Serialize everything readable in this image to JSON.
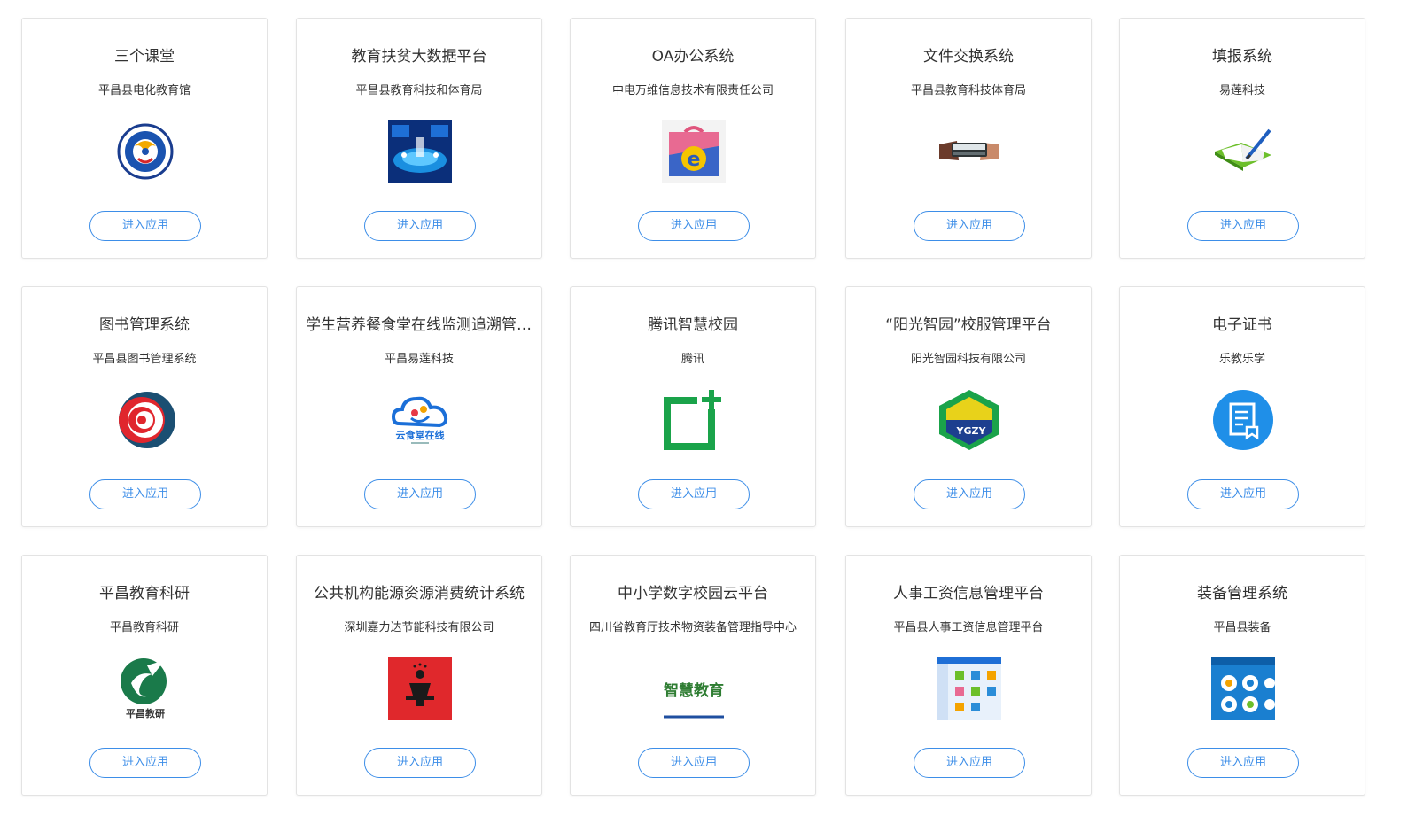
{
  "apps": [
    {
      "title": "三个课堂",
      "org": "平昌县电化教育馆",
      "icon": "edu-emblem-icon",
      "button_label": "进入应用"
    },
    {
      "title": "教育扶贫大数据平台",
      "org": "平昌县教育科技和体育局",
      "icon": "big-data-dashboard-icon",
      "button_label": "进入应用"
    },
    {
      "title": "OA办公系统",
      "org": "中电万维信息技术有限责任公司",
      "icon": "briefcase-e-icon",
      "button_label": "进入应用"
    },
    {
      "title": "文件交换系统",
      "org": "平昌县教育科技体育局",
      "icon": "document-handover-icon",
      "button_label": "进入应用"
    },
    {
      "title": "填报系统",
      "org": "易莲科技",
      "icon": "notebook-pen-icon",
      "button_label": "进入应用"
    },
    {
      "title": "图书管理系统",
      "org": "平昌县图书管理系统",
      "icon": "swirl-logo-icon",
      "button_label": "进入应用"
    },
    {
      "title": "学生营养餐食堂在线监测追溯管理系统",
      "org": "平昌易莲科技",
      "icon": "cloud-canteen-icon",
      "logo_text": "云食堂在线",
      "button_label": "进入应用"
    },
    {
      "title": "腾讯智慧校园",
      "org": "腾讯",
      "icon": "smart-campus-icon",
      "button_label": "进入应用"
    },
    {
      "title": "“阳光智园”校服管理平台",
      "org": "阳光智园科技有限公司",
      "icon": "ygzy-logo-icon",
      "logo_text": "YGZY",
      "button_label": "进入应用"
    },
    {
      "title": "电子证书",
      "org": "乐教乐学",
      "icon": "certificate-icon",
      "button_label": "进入应用"
    },
    {
      "title": "平昌教育科研",
      "org": "平昌教育科研",
      "icon": "edu-research-logo-icon",
      "logo_text": "平昌教研",
      "button_label": "进入应用"
    },
    {
      "title": "公共机构能源资源消费统计系统",
      "org": "深圳嘉力达节能科技有限公司",
      "icon": "energy-stats-icon",
      "button_label": "进入应用"
    },
    {
      "title": "中小学数字校园云平台",
      "org": "四川省教育厅技术物资装备管理指导中心",
      "icon": "smart-education-icon",
      "logo_text": "智慧教育",
      "button_label": "进入应用"
    },
    {
      "title": "人事工资信息管理平台",
      "org": "平昌县人事工资信息管理平台",
      "icon": "hr-salary-screen-icon",
      "button_label": "进入应用"
    },
    {
      "title": "装备管理系统",
      "org": "平昌县装备",
      "icon": "equipment-dashboard-icon",
      "button_label": "进入应用"
    }
  ]
}
